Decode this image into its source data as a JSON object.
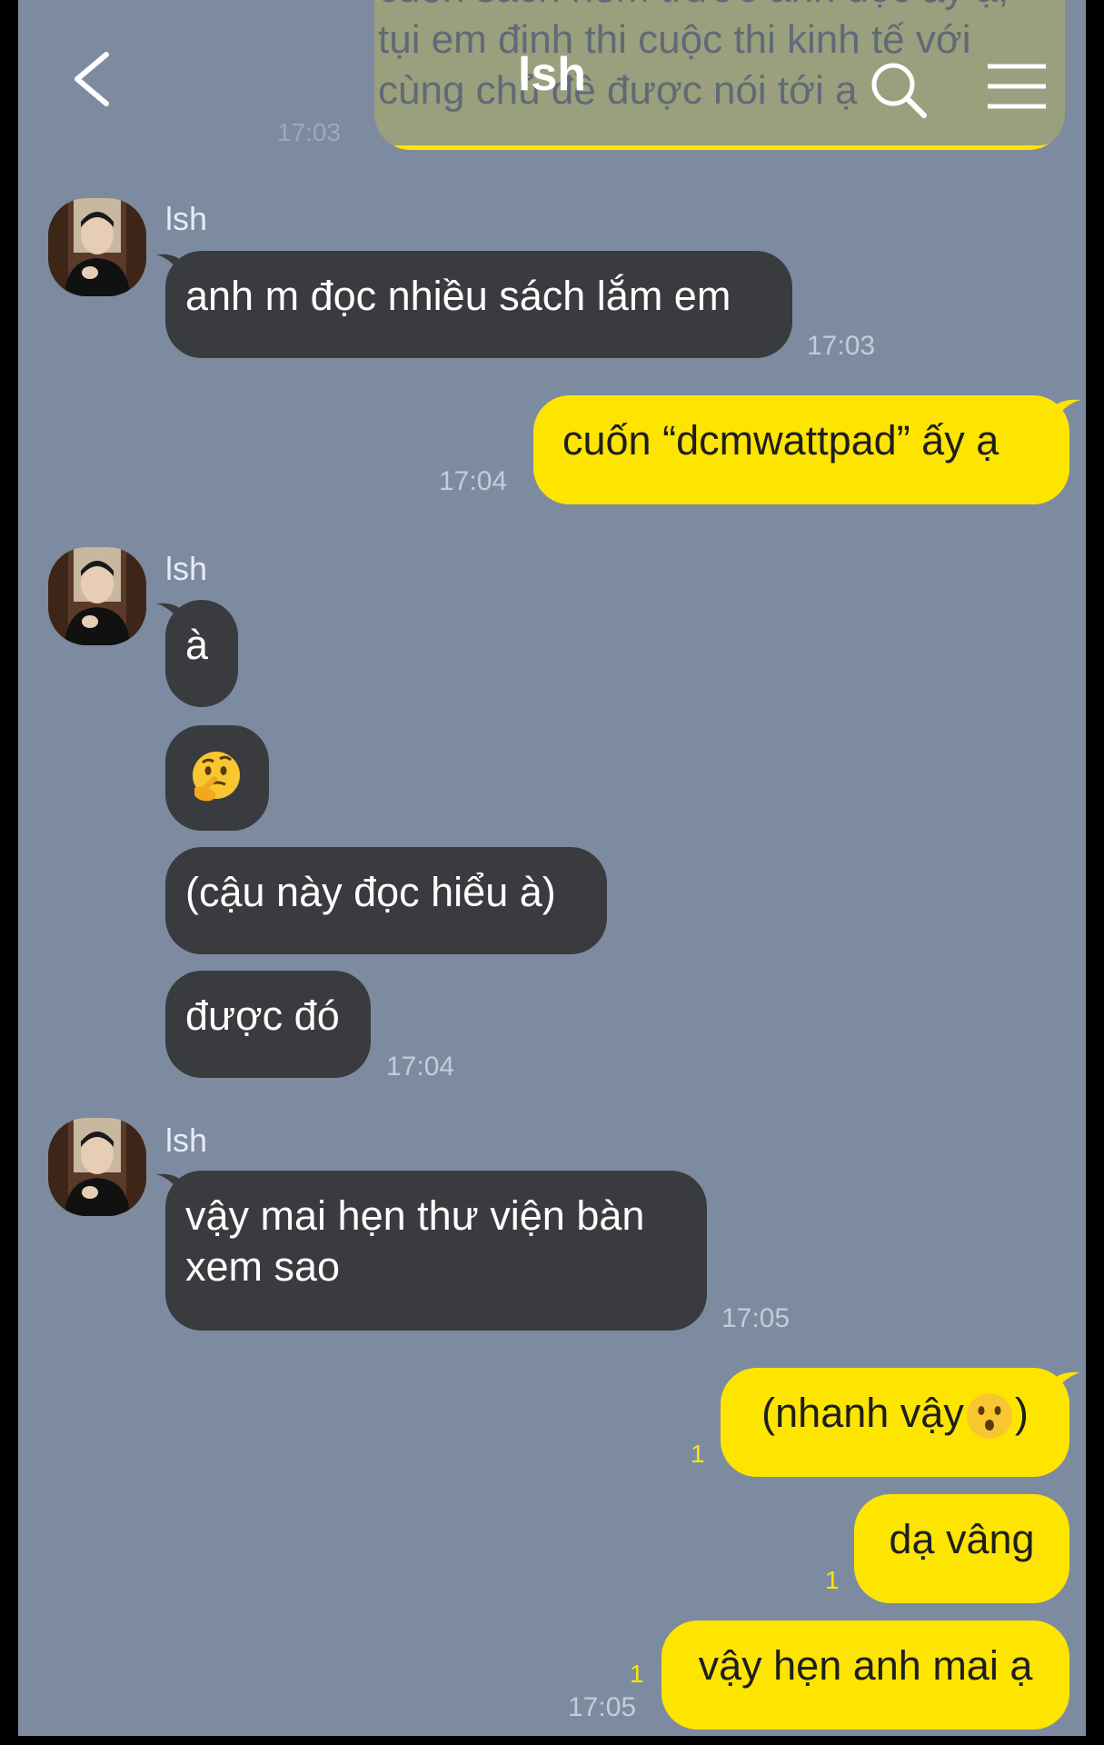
{
  "header": {
    "title": "lsh"
  },
  "previous_message": {
    "text": "cuốn sách hôm trước anh đọc ấy ạ, tụi em định thi cuộc thi kinh tế với cùng chủ đề được nói tới ạ",
    "time": "17:03"
  },
  "messages": [
    {
      "sender": "lsh",
      "text": "anh m đọc nhiều sách lắm em",
      "time": "17:03"
    },
    {
      "text": "cuốn “dcmwattpad” ấy ạ",
      "time": "17:04"
    },
    {
      "sender": "lsh",
      "text": "à"
    },
    {
      "text": "",
      "emoji": "thinking-face-emoji"
    },
    {
      "text": "(cậu này đọc hiểu à)"
    },
    {
      "text": "được đó",
      "time": "17:04"
    },
    {
      "sender": "lsh",
      "line1": "vậy mai hẹn thư viện bàn",
      "line2": "xem sao",
      "time": "17:05"
    },
    {
      "text_before": "(nhanh vậy",
      "text_after": ")",
      "emoji": "hushed-face-emoji",
      "unread": "1"
    },
    {
      "text": "dạ vâng",
      "unread": "1"
    },
    {
      "text": "vậy hẹn anh mai ạ",
      "unread": "1",
      "time": "17:05"
    }
  ],
  "colors": {
    "background": "#7d8ba0",
    "incoming_bubble": "#3a3b3f",
    "outgoing_bubble": "#fee500",
    "unread": "#fee500"
  }
}
